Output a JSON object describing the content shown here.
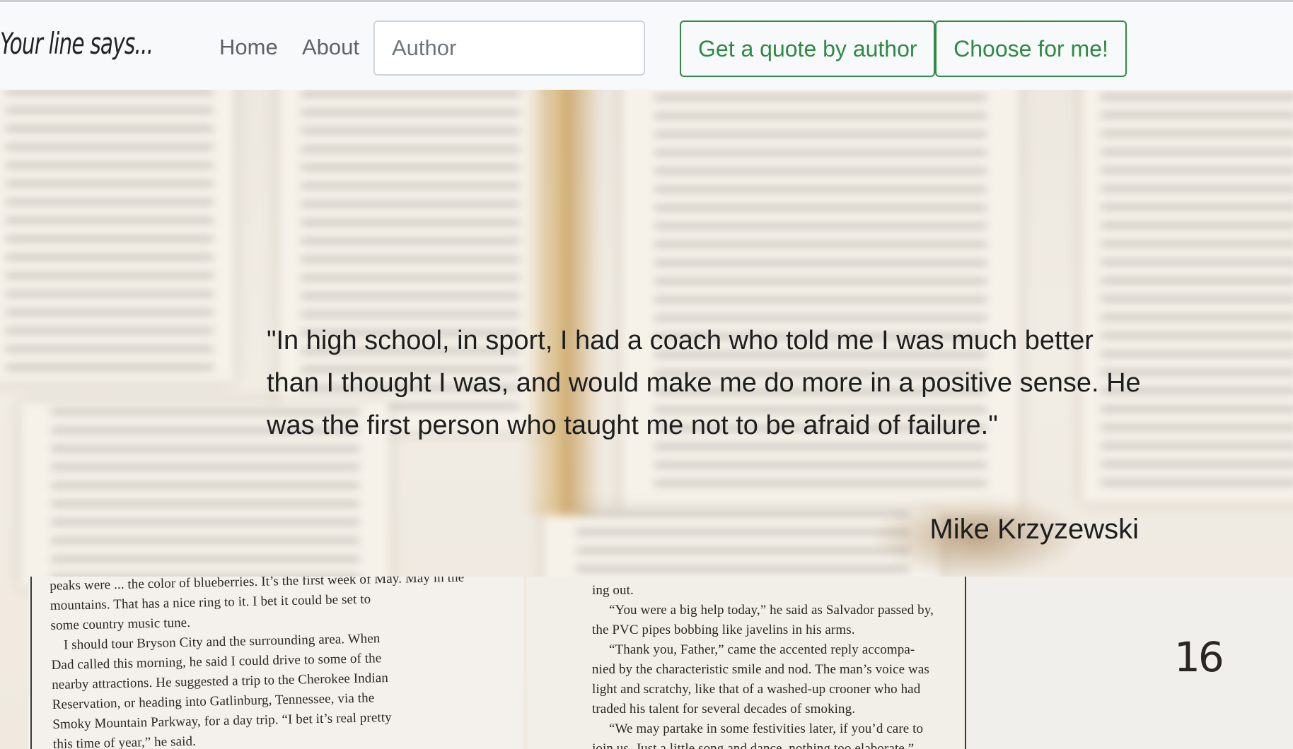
{
  "navbar": {
    "brand": "Your line says...",
    "links": [
      {
        "label": "Home"
      },
      {
        "label": "About"
      }
    ],
    "author_input": {
      "placeholder": "Author",
      "value": ""
    },
    "buttons": {
      "get_quote": "Get a quote by author",
      "choose": "Choose for me!"
    }
  },
  "quote": {
    "text": "\"In high school, in sport, I had a coach who told me I was much better than I thought I was, and would make me do more in a positive sense. He was the first person who taught me not to be afraid of failure.\"",
    "author": "Mike Krzyzewski"
  },
  "background": {
    "page_number": "16",
    "left_page_lines": [
      "peaks were ... the color of blueberries. It’s the first week of May. May in the",
      "mountains. That has a nice ring to it. I bet it could be set to",
      "some country music tune.",
      "I should tour Bryson City and the surrounding area. When",
      "Dad called this morning, he said I could drive to some of the",
      "nearby attractions. He suggested a trip to the Cherokee Indian",
      "Reservation, or heading into Gatlinburg, Tennessee, via the",
      "Smoky Mountain Parkway, for a day trip. “I bet it’s real pretty",
      "this time of year,” he said."
    ],
    "middle_page_lines": [
      "ing out.",
      "“You were a big help today,” he said as Salvador passed by,",
      "the PVC pipes bobbing like javelins in his arms.",
      "“Thank you, Father,” came the accented reply accompa-",
      "nied by the characteristic smile and nod. The man’s voice was",
      "light and scratchy, like that of a washed-up crooner who had",
      "traded his talent for several decades of smoking.",
      "“We may partake in some festivities later, if you’d care to",
      "join us. Just a little song and dance, nothing too elaborate.”"
    ]
  }
}
